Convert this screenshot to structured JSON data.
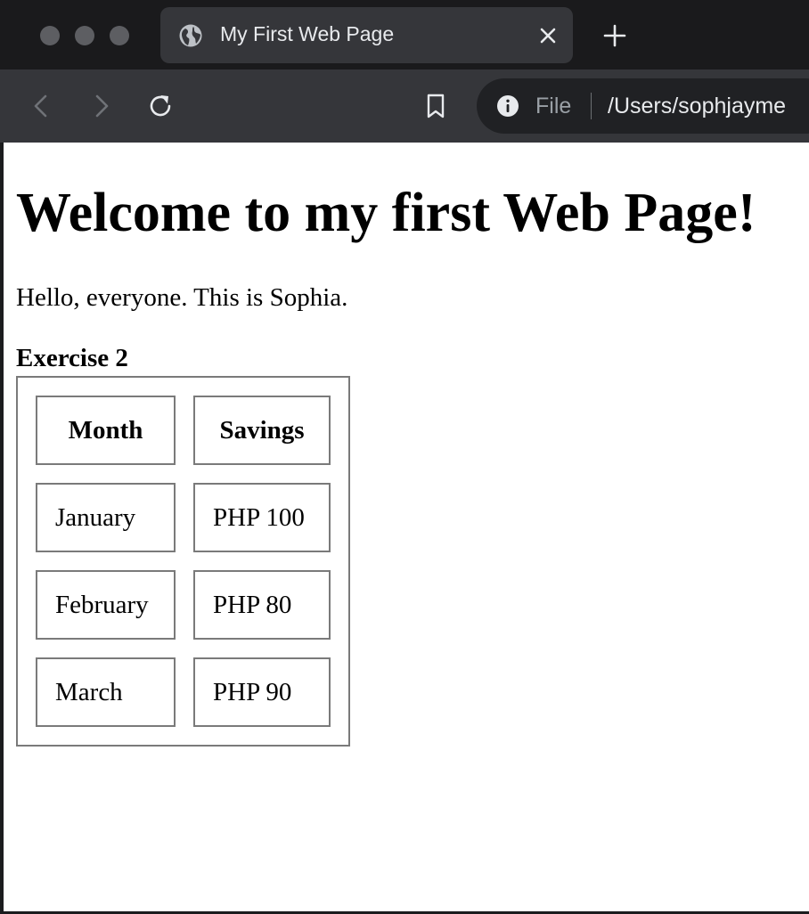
{
  "tab": {
    "title": "My First Web Page"
  },
  "toolbar": {
    "scheme_label": "File",
    "url": "/Users/sophjayme"
  },
  "page": {
    "heading": "Welcome to my first Web Page!",
    "intro": "Hello, everyone. This is Sophia.",
    "table": {
      "caption": "Exercise 2",
      "headers": [
        "Month",
        "Savings"
      ],
      "rows": [
        [
          "January",
          "PHP 100"
        ],
        [
          "February",
          "PHP 80"
        ],
        [
          "March",
          "PHP 90"
        ]
      ]
    }
  },
  "icons": {
    "tab_favicon": "globe-icon",
    "tab_close": "close-icon",
    "new_tab": "plus-icon",
    "back": "back-arrow-icon",
    "forward": "forward-arrow-icon",
    "reload": "reload-icon",
    "bookmark": "bookmark-icon",
    "site_info": "info-icon"
  },
  "colors": {
    "tab_strip": "#1a1a1c",
    "toolbar": "#35363a",
    "omnibox": "#202124",
    "page_background": "#ffffff"
  }
}
